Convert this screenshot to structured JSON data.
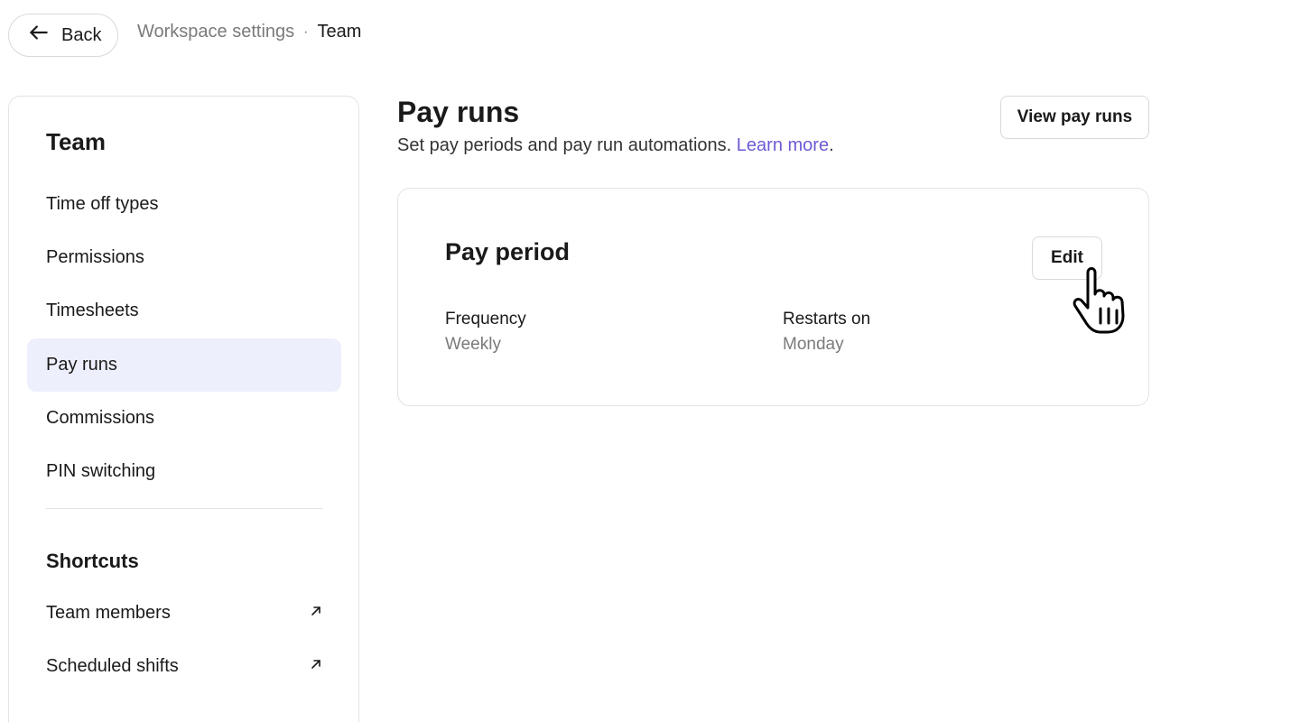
{
  "topbar": {
    "back_label": "Back",
    "breadcrumb": {
      "parent": "Workspace settings",
      "separator": "·",
      "current": "Team"
    }
  },
  "sidebar": {
    "title": "Team",
    "items": [
      {
        "label": "Time off types"
      },
      {
        "label": "Permissions"
      },
      {
        "label": "Timesheets"
      },
      {
        "label": "Pay runs",
        "active": true
      },
      {
        "label": "Commissions"
      },
      {
        "label": "PIN switching"
      }
    ],
    "shortcuts_title": "Shortcuts",
    "shortcuts": [
      {
        "label": "Team members",
        "icon": "external-link-icon"
      },
      {
        "label": "Scheduled shifts",
        "icon": "external-link-icon"
      }
    ]
  },
  "main": {
    "title": "Pay runs",
    "subtitle": "Set pay periods and pay run automations.",
    "learn_more": "Learn more",
    "subtitle_end": ".",
    "view_button": "View pay runs",
    "card": {
      "title": "Pay period",
      "edit_label": "Edit",
      "fields": [
        {
          "label": "Frequency",
          "value": "Weekly"
        },
        {
          "label": "Restarts on",
          "value": "Monday"
        }
      ]
    }
  },
  "colors": {
    "accent_link": "#6b5bd6",
    "active_nav_bg": "#eeeffc",
    "muted_text": "#7a7a7a",
    "border": "#e3e3e3"
  }
}
